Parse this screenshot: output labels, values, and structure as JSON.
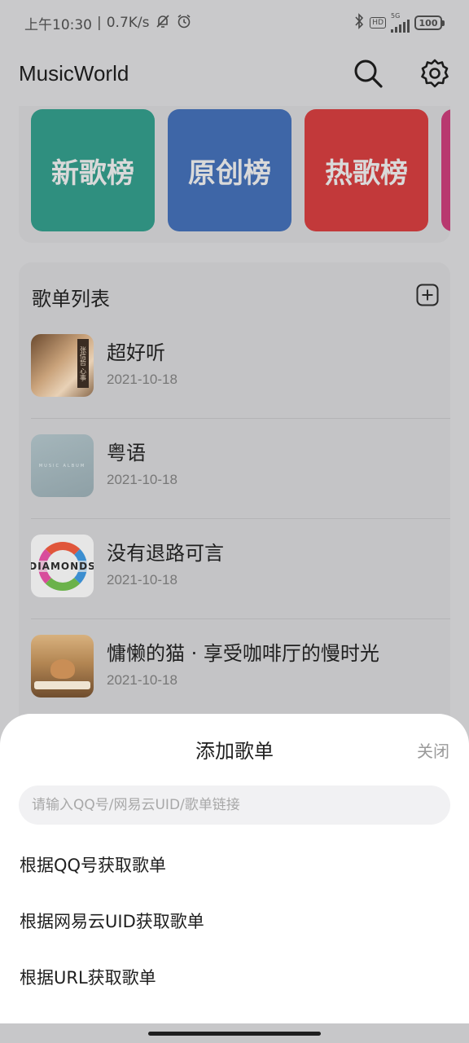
{
  "status_bar": {
    "time": "上午10:30",
    "separator": "|",
    "network_speed": "0.7K/s",
    "battery": "100",
    "hd": "HD",
    "signal_label": "5G",
    "icons": [
      "mute-bell-icon",
      "alarm-icon",
      "bluetooth-icon",
      "hd-icon",
      "signal-icon",
      "battery-icon"
    ]
  },
  "app_bar": {
    "title": "MusicWorld",
    "icons": [
      "search-icon",
      "gear-icon"
    ]
  },
  "charts": {
    "tiles": [
      {
        "label": "新歌榜",
        "color": "#2f8f7f"
      },
      {
        "label": "原创榜",
        "color": "#3e66a7"
      },
      {
        "label": "热歌榜",
        "color": "#c2393a"
      },
      {
        "label": "",
        "color": "#b8386f"
      }
    ]
  },
  "playlists": {
    "heading": "歌单列表",
    "add_icon": "add-square-icon",
    "items": [
      {
        "title": "超好听",
        "date": "2021-10-18",
        "cover_text": "张信哲 心事"
      },
      {
        "title": "粤语",
        "date": "2021-10-18",
        "cover_text": "MUSIC ALBUM"
      },
      {
        "title": "没有退路可言",
        "date": "2021-10-18",
        "cover_text": "DIAMONDS"
      },
      {
        "title": "慵懒的猫 · 享受咖啡厅的慢时光",
        "date": "2021-10-18",
        "cover_text": ""
      }
    ]
  },
  "sheet": {
    "title": "添加歌单",
    "close": "关闭",
    "input_placeholder": "请输入QQ号/网易云UID/歌单链接",
    "input_value": "",
    "options": [
      "根据QQ号获取歌单",
      "根据网易云UID获取歌单",
      "根据URL获取歌单"
    ]
  },
  "colors": {
    "scrim": "#c9c9cb",
    "sheet_bg": "#ffffff",
    "input_bg": "#f1f1f3",
    "muted_text": "#9a9a9a"
  }
}
